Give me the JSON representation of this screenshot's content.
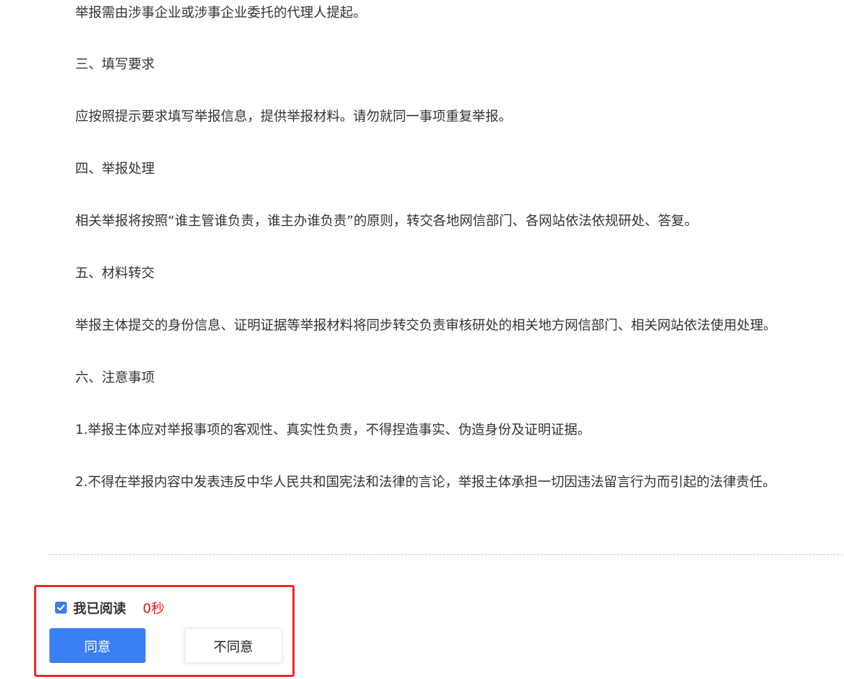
{
  "notice": {
    "lines": [
      "举报需由涉事企业或涉事企业委托的代理人提起。",
      "三、填写要求",
      "应按照提示要求填写举报信息，提供举报材料。请勿就同一事项重复举报。",
      "四、举报处理",
      "相关举报将按照“谁主管谁负责，谁主办谁负责”的原则，转交各地网信部门、各网站依法依规研处、答复。",
      "五、材料转交",
      "举报主体提交的身份信息、证明证据等举报材料将同步转交负责审核研处的相关地方网信部门、相关网站依法使用处理。",
      "六、注意事项",
      "1.举报主体应对举报事项的客观性、真实性负责，不得捏造事实、伪造身份及证明证据。",
      "2.不得在举报内容中发表违反中华人民共和国宪法和法律的言论，举报主体承担一切因违法留言行为而引起的法律责任。"
    ]
  },
  "consent": {
    "read_label": "我已阅读",
    "checked": true,
    "countdown": "0秒",
    "agree_label": "同意",
    "disagree_label": "不同意"
  },
  "colors": {
    "accent": "#3a7ff3",
    "highlight_border": "#f02424",
    "countdown": "#e8151a"
  }
}
